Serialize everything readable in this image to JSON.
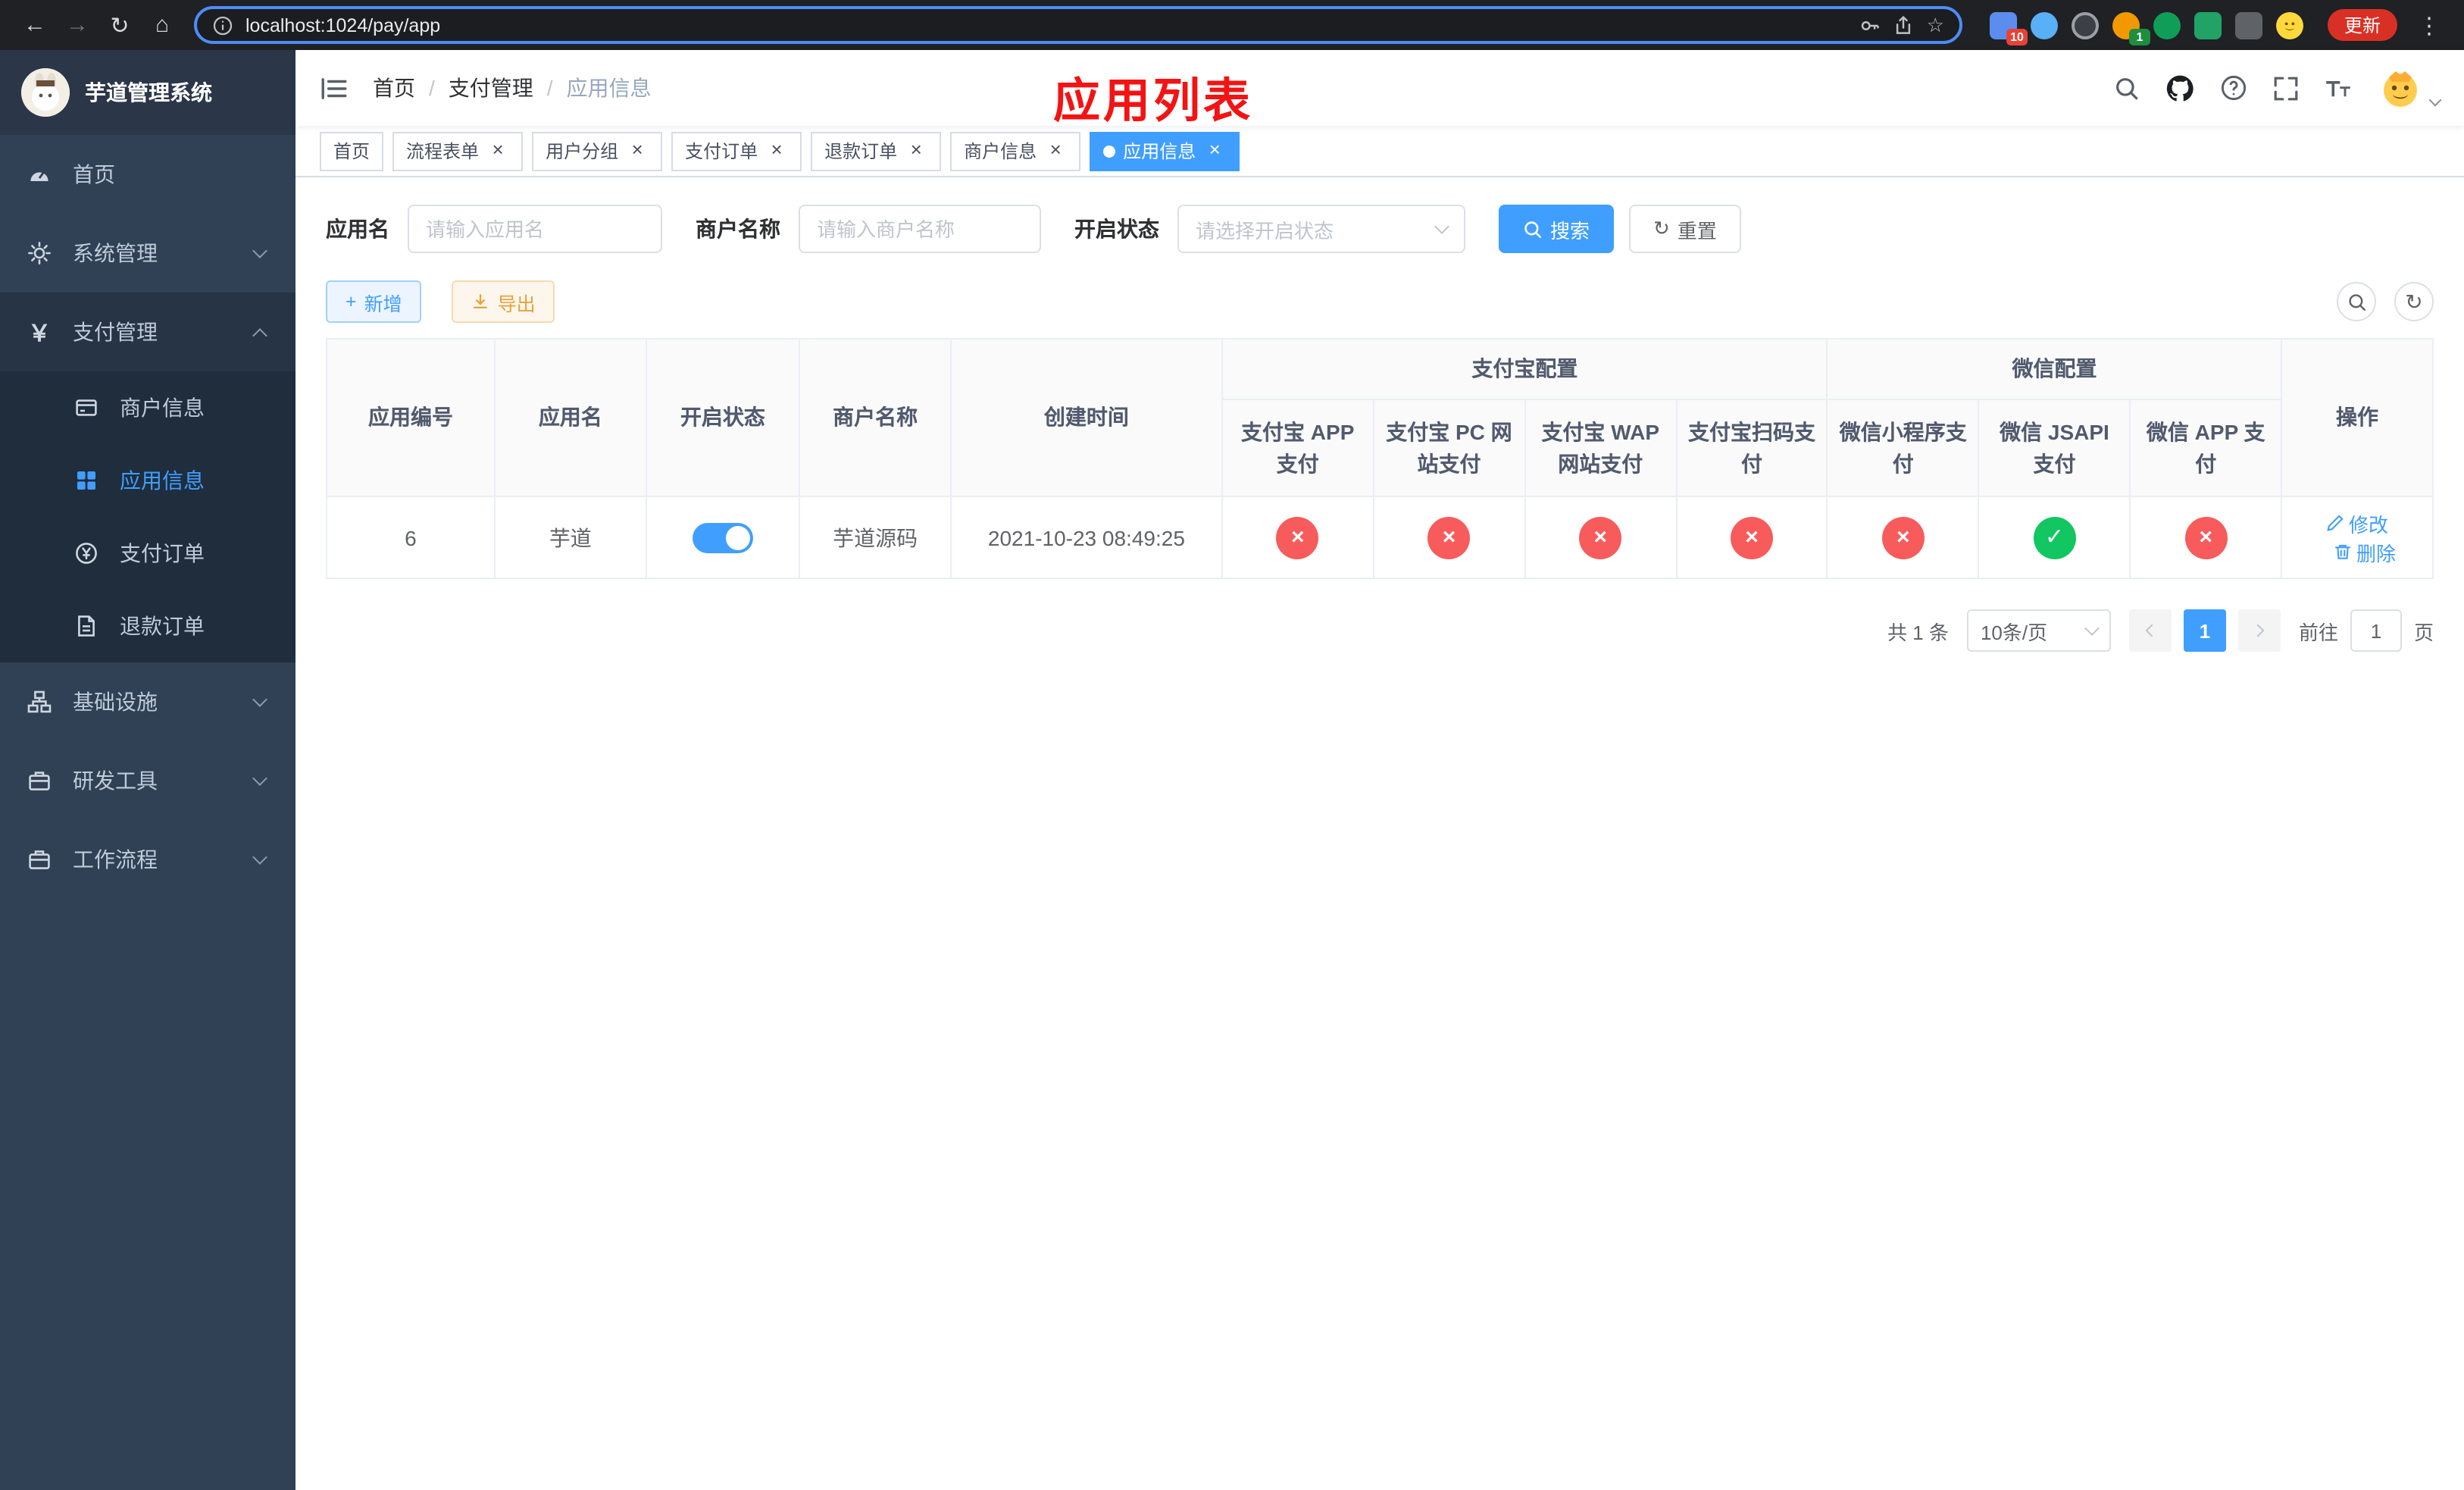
{
  "browser": {
    "url": "localhost:1024/pay/app",
    "update_button": "更新",
    "ext_badge_grid": "10",
    "ext_badge_translate": "1"
  },
  "annotation": {
    "page_title": "应用列表"
  },
  "icons": {
    "close": "×",
    "cross": "×",
    "check": "✓",
    "plus": "+",
    "refresh": "↻",
    "yen": "￥",
    "back": "←",
    "forward": "→",
    "reload": "↻",
    "home": "⌂",
    "star": "☆",
    "dots": "⋮"
  },
  "colors": {
    "primary": "#409EFF",
    "danger": "#f85b5b",
    "success": "#12c662",
    "warning": "#e6a23c",
    "annotation_red": "#f21414",
    "sidebar_bg": "#304156"
  },
  "sidebar": {
    "app_title": "芋道管理系统",
    "items": {
      "home": "首页",
      "system": "系统管理",
      "payment": "支付管理",
      "infra": "基础设施",
      "devtools": "研发工具",
      "workflow": "工作流程"
    },
    "payment_children": {
      "merchant": "商户信息",
      "app": "应用信息",
      "order": "支付订单",
      "refund": "退款订单"
    }
  },
  "breadcrumb": {
    "items": [
      "首页",
      "支付管理",
      "应用信息"
    ],
    "separator": "/"
  },
  "tabs": [
    {
      "label": "首页",
      "closable": false,
      "active": false
    },
    {
      "label": "流程表单",
      "closable": true,
      "active": false
    },
    {
      "label": "用户分组",
      "closable": true,
      "active": false
    },
    {
      "label": "支付订单",
      "closable": true,
      "active": false
    },
    {
      "label": "退款订单",
      "closable": true,
      "active": false
    },
    {
      "label": "商户信息",
      "closable": true,
      "active": false
    },
    {
      "label": "应用信息",
      "closable": true,
      "active": true
    }
  ],
  "search_form": {
    "app_name_label": "应用名",
    "app_name_placeholder": "请输入应用名",
    "merchant_label": "商户名称",
    "merchant_placeholder": "请输入商户名称",
    "status_label": "开启状态",
    "status_placeholder": "请选择开启状态",
    "search_button": "搜索",
    "reset_button": "重置"
  },
  "toolbar": {
    "add_button": "新增",
    "export_button": "导出"
  },
  "table": {
    "headers": {
      "app_id": "应用编号",
      "app_name": "应用名",
      "status": "开启状态",
      "merchant_name": "商户名称",
      "create_time": "创建时间",
      "alipay_group": "支付宝配置",
      "wechat_group": "微信配置",
      "alipay_app": "支付宝 APP 支付",
      "alipay_pc": "支付宝 PC 网站支付",
      "alipay_wap": "支付宝 WAP 网站支付",
      "alipay_qr": "支付宝扫码支付",
      "wx_lite": "微信小程序支付",
      "wx_jsapi": "微信 JSAPI 支付",
      "wx_app": "微信 APP 支付",
      "actions": "操作"
    },
    "rows": [
      {
        "id": "6",
        "name": "芋道",
        "enabled": true,
        "merchant": "芋道源码",
        "created": "2021-10-23 08:49:25",
        "channels": {
          "alipay_app": false,
          "alipay_pc": false,
          "alipay_wap": false,
          "alipay_qr": false,
          "wx_lite": false,
          "wx_jsapi": true,
          "wx_app": false
        },
        "actions": {
          "edit": "修改",
          "delete": "删除"
        }
      }
    ]
  },
  "pagination": {
    "total_text": "共 1 条",
    "page_size": "10条/页",
    "current_page": "1",
    "jump_prefix": "前往",
    "jump_value": "1",
    "jump_suffix": "页"
  }
}
